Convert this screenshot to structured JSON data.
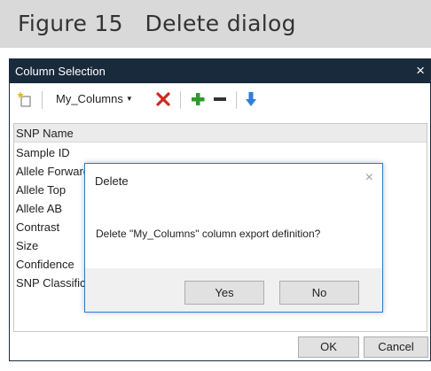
{
  "figure": {
    "title": "Figure 15   Delete dialog"
  },
  "window": {
    "title": "Column Selection",
    "close_glyph": "×",
    "toolbar": {
      "new_icon": "new-item-icon",
      "dropdown_label": "My_Columns",
      "dropdown_caret": "▼",
      "delete_icon": "red-x-delete-icon",
      "add_icon": "green-plus-icon",
      "remove_icon": "minus-icon",
      "move_down_icon": "blue-down-arrow-icon"
    },
    "list": {
      "header": "SNP Name",
      "items": [
        "Sample ID",
        "Allele Forward",
        "Allele Top",
        "Allele AB",
        "Contrast",
        "Size",
        "Confidence",
        "SNP Classification"
      ]
    },
    "ok_label": "OK",
    "cancel_label": "Cancel"
  },
  "dialog": {
    "title": "Delete",
    "close_glyph": "×",
    "message": "Delete \"My_Columns\" column export definition?",
    "yes_label": "Yes",
    "no_label": "No"
  },
  "colors": {
    "titlebar": "#192a3c",
    "dialog_border": "#2b7bd0",
    "delete_red": "#cc2a1f",
    "add_green": "#2e9a2e",
    "arrow_blue": "#2f7fd6"
  }
}
